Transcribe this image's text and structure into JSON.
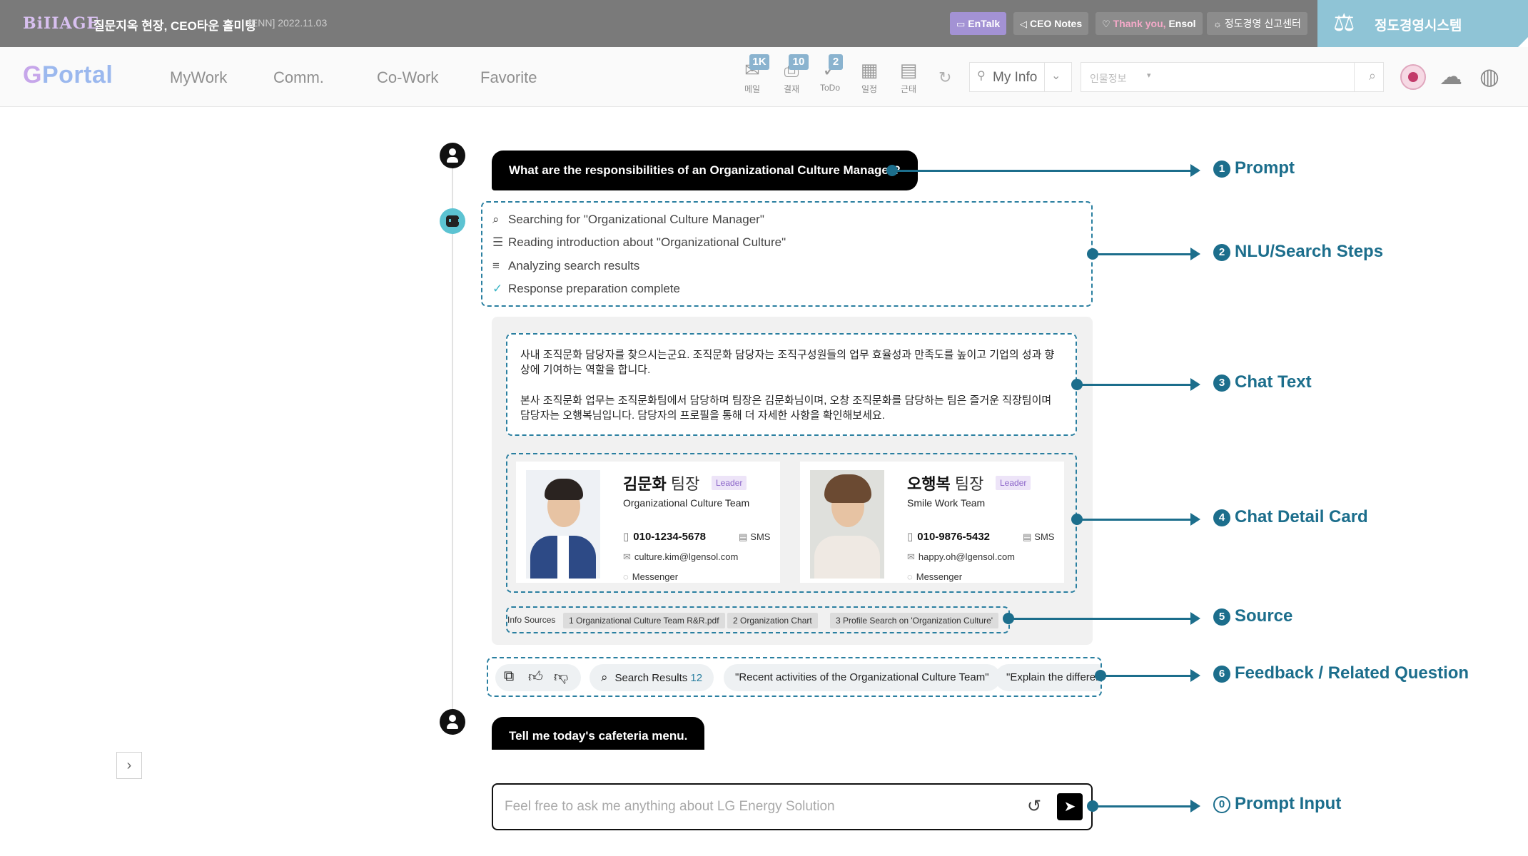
{
  "topbar": {
    "logo": "BiIIAGE",
    "notice_title": "질문지옥 현장, CEO타운 홀미팅",
    "notice_date": "[ENN] 2022.11.03",
    "chips": {
      "entalk": "EnTalk",
      "ceo_notes": "CEO Notes",
      "thanks_prefix": "Thank you,",
      "thanks_name": "Ensol",
      "ethics_center": "정도경영 신고센터"
    },
    "ethics_system": "정도경영시스템"
  },
  "nav": {
    "brand_g": "G",
    "brand_rest": "Portal",
    "items": [
      "MyWork",
      "Comm.",
      "Co-Work",
      "Favorite"
    ],
    "tools": [
      {
        "label": "메일",
        "badge": "1K",
        "icon": "mail-icon"
      },
      {
        "label": "결재",
        "badge": "10",
        "icon": "approval-icon"
      },
      {
        "label": "ToDo",
        "badge": "2",
        "icon": "todo-icon"
      },
      {
        "label": "일정",
        "badge": "",
        "icon": "calendar-icon"
      },
      {
        "label": "근태",
        "badge": "",
        "icon": "attendance-icon"
      }
    ],
    "my_info": "My Info",
    "people_search_placeholder": "인물정보"
  },
  "chat": {
    "prompt1": "What are the responsibilities of an Organizational Culture Manager?",
    "steps": [
      "Searching for \"Organizational Culture Manager\"",
      "Reading introduction about \"Organizational Culture\"",
      "Analyzing search results",
      "Response preparation complete"
    ],
    "answer_paragraphs": [
      "사내 조직문화 담당자를 찾으시는군요. 조직문화 담당자는 조직구성원들의 업무 효율성과 만족도를 높이고 기업의 성과 향상에 기여하는 역할을 합니다.",
      "본사 조직문화 업무는 조직문화팀에서 담당하며 팀장은 김문화님이며, 오창 조직문화를 담당하는 팀은 즐거운 직장팀이며 담당자는 오행복님입니다. 담당자의 프로필을 통해 더 자세한 사항을 확인해보세요."
    ],
    "cards": [
      {
        "name": "김문화",
        "rank": "팀장",
        "badge": "Leader",
        "team": "Organizational Culture Team",
        "phone": "010-1234-5678",
        "sms": "SMS",
        "email": "culture.kim@lgensol.com",
        "messenger": "Messenger"
      },
      {
        "name": "오행복",
        "rank": "팀장",
        "badge": "Leader",
        "team": "Smile Work Team",
        "phone": "010-9876-5432",
        "sms": "SMS",
        "email": "happy.oh@lgensol.com",
        "messenger": "Messenger"
      }
    ],
    "sources_label": "Info Sources",
    "sources": [
      "1  Organizational Culture Team R&R.pdf",
      "2  Organization Chart",
      "3  Profile Search on 'Organization Culture'"
    ],
    "feedback": {
      "search_results_label": "Search Results",
      "search_results_count": "12",
      "related_questions": [
        "\"Recent activities of the Organizational Culture Team\"",
        "\"Explain the differer"
      ]
    },
    "prompt2": "Tell me today's cafeteria menu.",
    "input_placeholder": "Feel free to ask me anything about LG Energy Solution"
  },
  "annotations": [
    {
      "num": "1",
      "label": "Prompt"
    },
    {
      "num": "2",
      "label": "NLU/Search Steps"
    },
    {
      "num": "3",
      "label": "Chat Text"
    },
    {
      "num": "4",
      "label": "Chat Detail Card"
    },
    {
      "num": "5",
      "label": "Source"
    },
    {
      "num": "6",
      "label": "Feedback / Related Question"
    },
    {
      "num": "0",
      "label": "Prompt Input"
    }
  ],
  "colors": {
    "annotation": "#1c6e8c",
    "topbar": "#7a7a7a",
    "ethics_panel": "#8fc4d6",
    "entalk_chip": "#a392d4"
  }
}
